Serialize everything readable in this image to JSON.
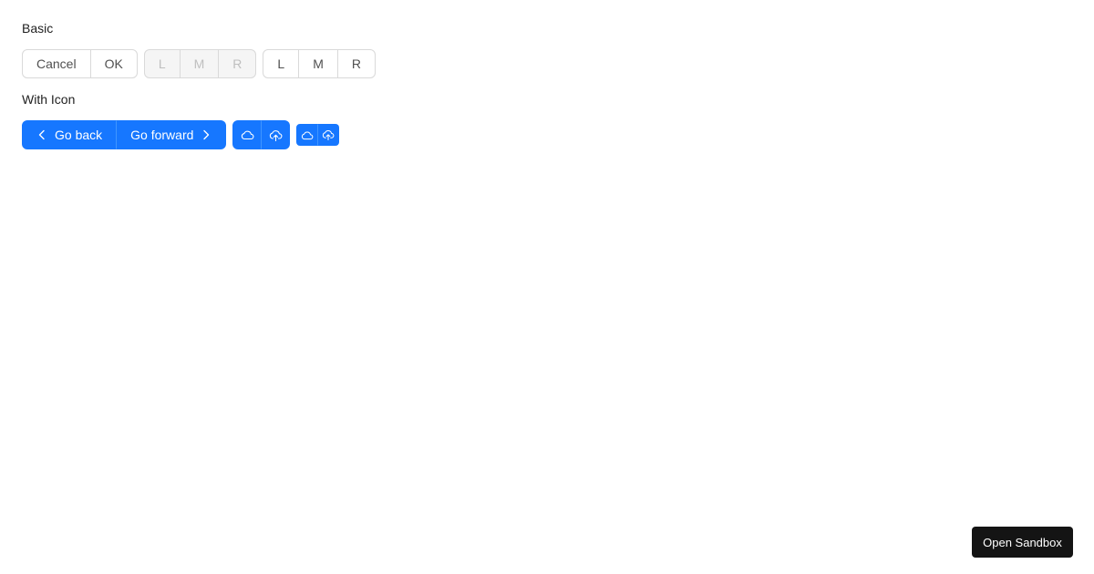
{
  "sections": {
    "basic_title": "Basic",
    "icon_title": "With Icon"
  },
  "basic": {
    "group1": [
      "Cancel",
      "OK"
    ],
    "group2_disabled": [
      "L",
      "M",
      "R"
    ],
    "group3": [
      "L",
      "M",
      "R"
    ]
  },
  "with_icon": {
    "go_back": "Go back",
    "go_forward": "Go forward",
    "icons": [
      "chevron-left-icon",
      "chevron-right-icon",
      "cloud-icon",
      "cloud-upload-icon"
    ]
  },
  "sandbox_button": "Open Sandbox",
  "colors": {
    "primary": "#1677ff",
    "border": "#d9d9d9",
    "disabled_bg": "#f5f5f5",
    "disabled_text": "#bfbfbf",
    "sandbox_bg": "#141414"
  }
}
